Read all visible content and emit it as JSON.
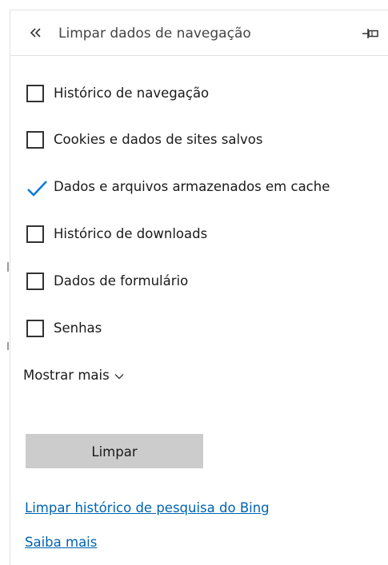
{
  "header": {
    "back_icon": "double-chevron-left-icon",
    "title": "Limpar dados de navegação",
    "pin_icon": "pin-icon"
  },
  "options": [
    {
      "label": "Histórico de navegação",
      "checked": false
    },
    {
      "label": "Cookies e dados de sites salvos",
      "checked": false
    },
    {
      "label": "Dados e arquivos armazenados em cache",
      "checked": true
    },
    {
      "label": "Histórico de downloads",
      "checked": false
    },
    {
      "label": "Dados de formulário",
      "checked": false
    },
    {
      "label": "Senhas",
      "checked": false
    }
  ],
  "show_more": {
    "label": "Mostrar mais",
    "icon": "chevron-down-icon"
  },
  "clear_button": {
    "label": "Limpar"
  },
  "links": {
    "bing_history": "Limpar histórico de pesquisa do Bing",
    "learn_more": "Saiba mais"
  },
  "colors": {
    "accent": "#0078d7",
    "link": "#0063b1",
    "button_bg": "#cccccc"
  }
}
